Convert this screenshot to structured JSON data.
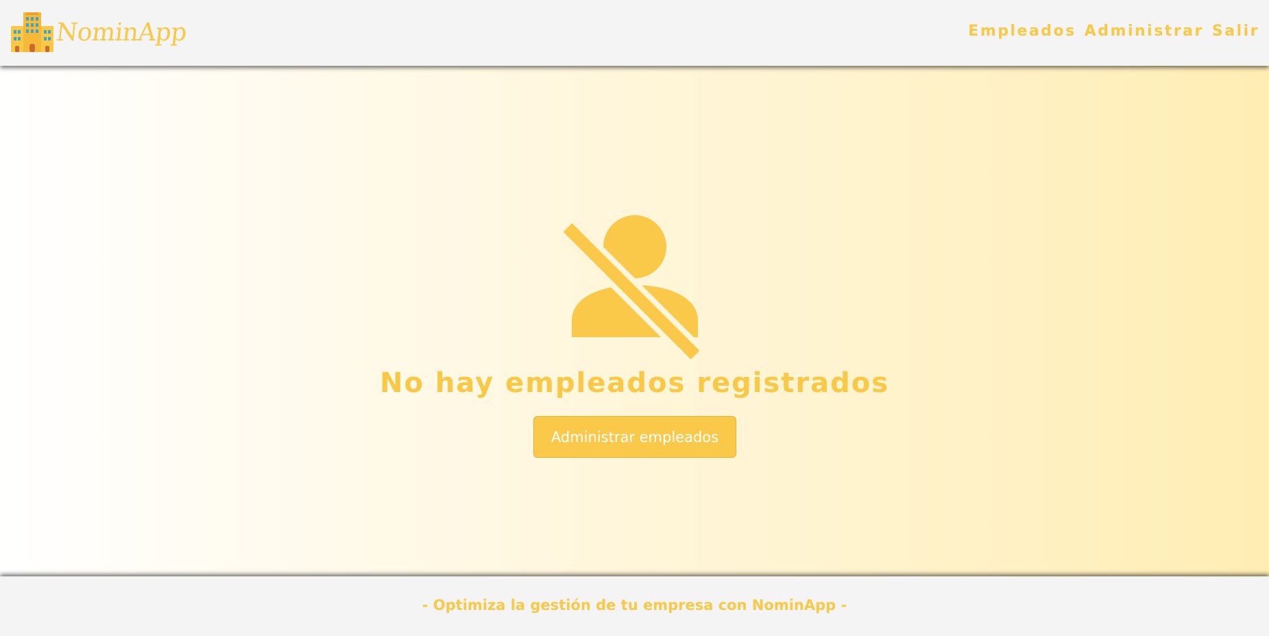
{
  "header": {
    "logo_text": "NominApp",
    "logo_icon": "building-icon",
    "nav": [
      {
        "label": "Empleados"
      },
      {
        "label": "Administrar"
      },
      {
        "label": "Salir"
      }
    ]
  },
  "main": {
    "empty_icon": "person-off-icon",
    "empty_title": "No hay empleados registrados",
    "button_label": "Administrar empleados"
  },
  "footer": {
    "tagline": "- Optimiza la gestión de tu empresa con NominApp -"
  },
  "colors": {
    "accent": "#f9c846",
    "header_bg": "#f4f4f4",
    "button_bg": "#fbc949"
  }
}
